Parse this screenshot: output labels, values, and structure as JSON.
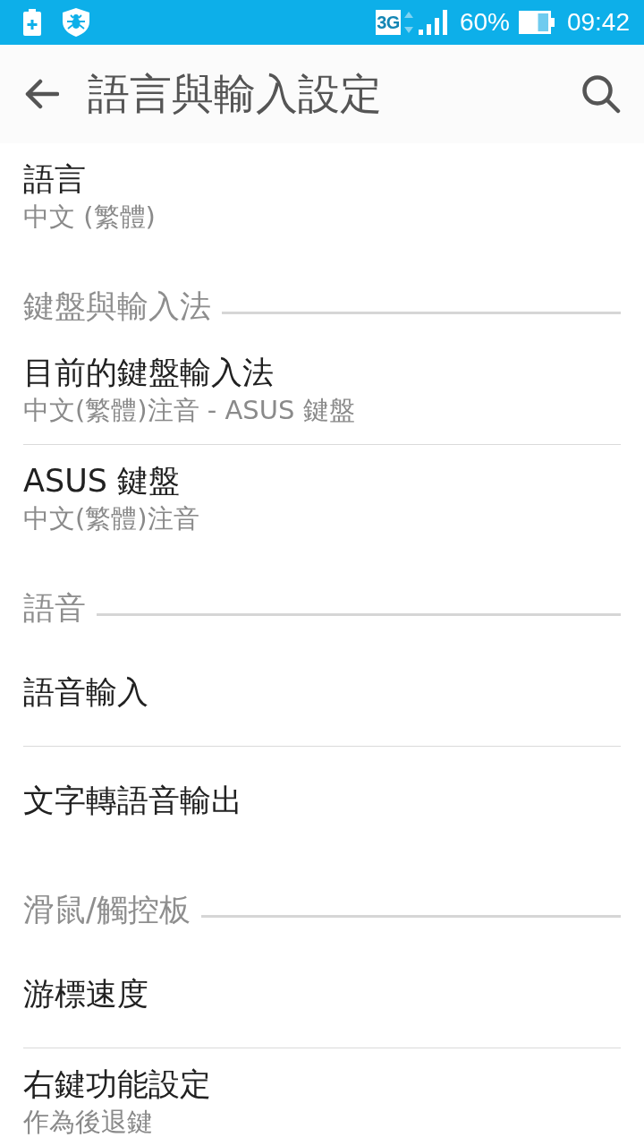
{
  "status_bar": {
    "network_type": "3G",
    "battery": "60%",
    "time": "09:42"
  },
  "app_bar": {
    "title": "語言與輸入設定"
  },
  "sections": [
    {
      "items": [
        {
          "title": "語言",
          "summary": "中文 (繁體)"
        }
      ]
    },
    {
      "header": "鍵盤與輸入法",
      "items": [
        {
          "title": "目前的鍵盤輸入法",
          "summary": "中文(繁體)注音 - ASUS 鍵盤"
        },
        {
          "title": "ASUS 鍵盤",
          "summary": "中文(繁體)注音"
        }
      ]
    },
    {
      "header": "語音",
      "items": [
        {
          "title": "語音輸入"
        },
        {
          "title": "文字轉語音輸出"
        }
      ]
    },
    {
      "header": "滑鼠/觸控板",
      "items": [
        {
          "title": "游標速度"
        },
        {
          "title": "右鍵功能設定",
          "summary": "作為後退鍵"
        }
      ]
    }
  ]
}
